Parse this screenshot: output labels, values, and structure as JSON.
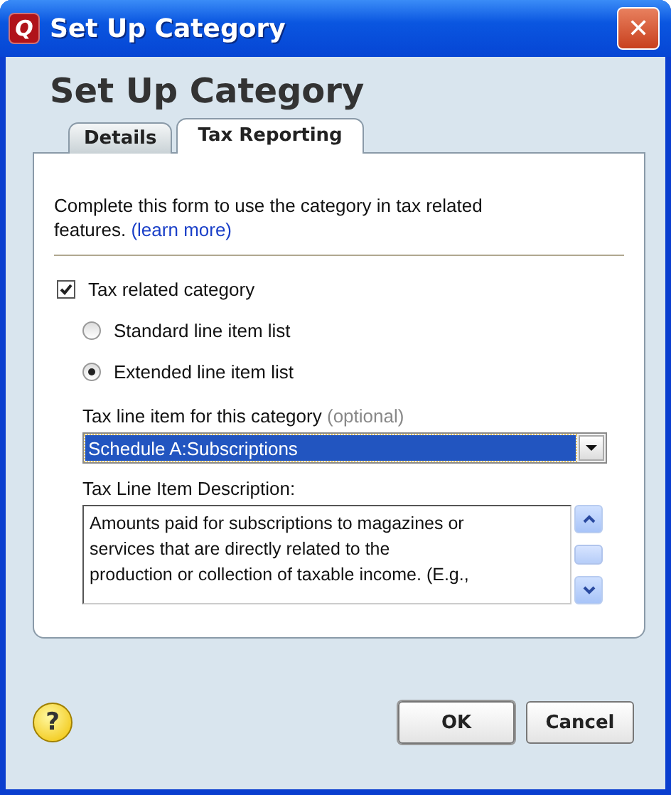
{
  "window": {
    "title": "Set Up Category",
    "app_icon": "Q",
    "close": "✕"
  },
  "heading": "Set Up Category",
  "tabs": [
    {
      "label": "Details",
      "selected": false
    },
    {
      "label": "Tax Reporting",
      "selected": true
    }
  ],
  "intro": {
    "text": "Complete this form to use the category in tax related features.",
    "link": "(learn more)"
  },
  "tax_related": {
    "label": "Tax related category",
    "checked": true
  },
  "line_item_lists": [
    {
      "label": "Standard line item list",
      "selected": false
    },
    {
      "label": "Extended line item list",
      "selected": true
    }
  ],
  "tax_line_item": {
    "label": "Tax line item for this category",
    "hint": "(optional)",
    "value": "Schedule A:Subscriptions"
  },
  "description": {
    "label": "Tax Line Item Description:",
    "text": "Amounts paid for subscriptions to magazines or\nservices that are directly related to the\nproduction or collection of taxable income.  (E.g.,"
  },
  "help": "?",
  "buttons": [
    "OK",
    "Cancel"
  ]
}
